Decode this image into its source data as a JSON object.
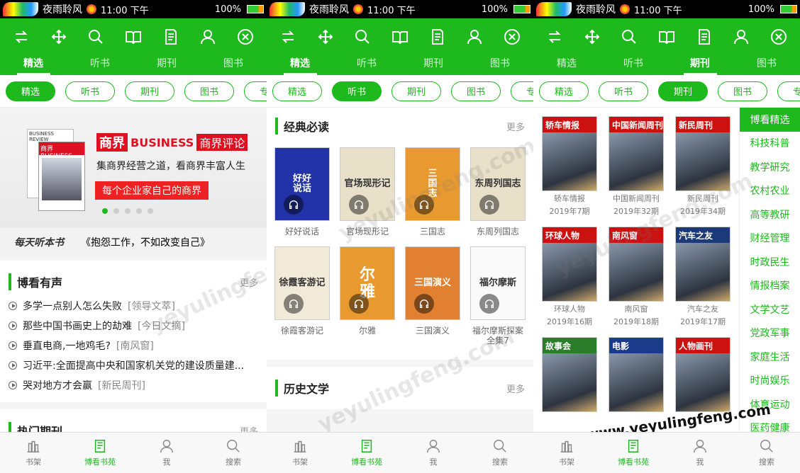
{
  "status": {
    "app": "夜雨聆风",
    "time": "11:00 下午",
    "battery": "100%"
  },
  "tabs": [
    "精选",
    "听书",
    "期刊",
    "图书"
  ],
  "chips": [
    "精选",
    "听书",
    "期刊",
    "图书",
    "专题"
  ],
  "pane1": {
    "banner": {
      "brand1": "商界",
      "brand2": "BUSINESS",
      "brand3": "商界评论",
      "slogan": "集商界经营之道，看商界丰富人生",
      "red": "每个企业家自己的商界",
      "magtop": "BUSINESS REVIEW",
      "mag2": "商界BUSINESS"
    },
    "daily_tag": "每天听本书",
    "daily_text": "《抱怨工作，不如改变自己》",
    "section_title": "博看有声",
    "more": "更多",
    "news": [
      {
        "t": "多学一点别人怎么失败",
        "s": "[领导文萃]"
      },
      {
        "t": "那些中国书画史上的劫难",
        "s": "[今日文摘]"
      },
      {
        "t": "垂直电商,一地鸡毛?",
        "s": "[南风窗]"
      },
      {
        "t": "习近平:全面提高中央和国家机关党的建设质量建...",
        "s": ""
      },
      {
        "t": "哭对地方才会赢",
        "s": "[新民周刊]"
      }
    ],
    "section2": "热门期刊"
  },
  "pane2": {
    "section1": "经典必读",
    "more": "更多",
    "books": [
      {
        "title": "好好说话",
        "cover": "好好\n说话",
        "color": "#2233aa"
      },
      {
        "title": "官场现形记",
        "cover": "官场现形记",
        "color": "#e8e0c8"
      },
      {
        "title": "三国志",
        "cover": "三\n国\n志",
        "color": "#e89a30"
      },
      {
        "title": "东周列国志",
        "cover": "东周列国志",
        "color": "#e8e0c8"
      },
      {
        "title": "徐霞客游记",
        "cover": "徐霞客游记",
        "color": "#f2ead8"
      },
      {
        "title": "尔雅",
        "cover": "尔\n雅",
        "color": "#e89a30"
      },
      {
        "title": "三国演义",
        "cover": "三国演义",
        "color": "#e08030"
      },
      {
        "title": "福尔摩斯探案全集7",
        "cover": "福尔摩斯",
        "color": "#fafafa"
      }
    ],
    "section2": "历史文学"
  },
  "pane3": {
    "mags": [
      {
        "name": "轿车情报",
        "issue": "2019年7期",
        "head": "轿车情报",
        "color": "#c11"
      },
      {
        "name": "中国新闻周刊",
        "issue": "2019年32期",
        "head": "中国新闻周刊",
        "color": "#c11"
      },
      {
        "name": "新民周刊",
        "issue": "2019年34期",
        "head": "新民周刊",
        "color": "#c11"
      },
      {
        "name": "环球人物",
        "issue": "2019年16期",
        "head": "环球人物",
        "color": "#c11"
      },
      {
        "name": "南风窗",
        "issue": "2019年18期",
        "head": "南风窗",
        "color": "#c11"
      },
      {
        "name": "汽车之友",
        "issue": "2019年17期",
        "head": "汽车之友",
        "color": "#1d3a78"
      },
      {
        "name": "",
        "issue": "",
        "head": "故事会",
        "color": "#2a7d2a"
      },
      {
        "name": "",
        "issue": "",
        "head": "电影",
        "color": "#1b3a8a"
      },
      {
        "name": "",
        "issue": "",
        "head": "人物画刊",
        "color": "#c11"
      }
    ],
    "cats": [
      "博看精选",
      "科技科普",
      "教学研究",
      "农村农业",
      "高等教研",
      "财经管理",
      "时政民生",
      "情报档案",
      "文学文艺",
      "党政军事",
      "家庭生活",
      "时尚娱乐",
      "体育运动",
      "医药健康"
    ]
  },
  "nav": [
    "书架",
    "博看书苑",
    "我",
    "搜索"
  ],
  "watermark": "yeyulingfeng.com",
  "watermark2": "www.yeyulingfeng.com",
  "colors": {
    "green": "#1db91d"
  }
}
